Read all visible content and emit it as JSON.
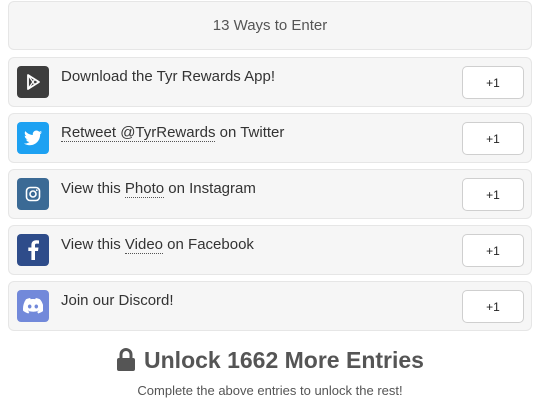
{
  "header": {
    "title": "13 Ways to Enter"
  },
  "entries": [
    {
      "pre": "Download the Tyr Rewards App!",
      "link": "",
      "post": "",
      "button": "+1",
      "icon": "play-store-icon",
      "color": "#3d3d3d"
    },
    {
      "pre": "",
      "link": "Retweet @TyrRewards",
      "post": " on Twitter",
      "button": "+1",
      "icon": "twitter-icon",
      "color": "#1da1f2"
    },
    {
      "pre": "View this ",
      "link": "Photo",
      "post": " on Instagram",
      "button": "+1",
      "icon": "instagram-icon",
      "color": "#3b6a95"
    },
    {
      "pre": "View this ",
      "link": "Video",
      "post": " on Facebook",
      "button": "+1",
      "icon": "facebook-icon",
      "color": "#2e4c8a"
    },
    {
      "pre": "Join our Discord!",
      "link": "",
      "post": "",
      "button": "+1",
      "icon": "discord-icon",
      "color": "#7289da"
    }
  ],
  "unlock": {
    "title": "Unlock 1662 More Entries",
    "subtitle": "Complete the above entries to unlock the rest!",
    "icon": "lock-icon"
  }
}
